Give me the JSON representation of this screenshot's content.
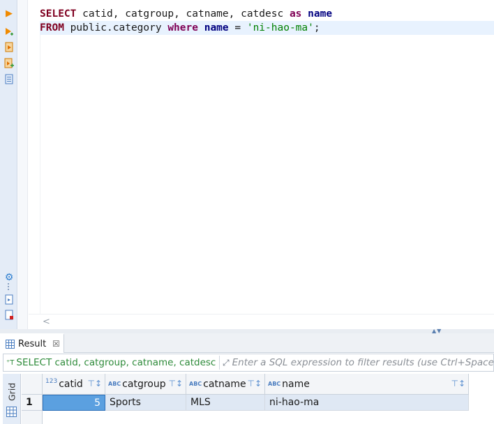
{
  "editor": {
    "line1": {
      "kw_select": "SELECT",
      "columns": " catid, catgroup, catname, catdesc ",
      "kw_as": "as",
      "space": " ",
      "alias": "name"
    },
    "line2": {
      "kw_from": "FROM",
      "table": " public.category ",
      "kw_where": "where",
      "space": " ",
      "col": "name",
      "op": " = ",
      "literal": "'ni-hao-ma'",
      "semicolon": ";"
    }
  },
  "result_panel": {
    "tab_label": "Result",
    "tab_close": "☒",
    "filter": {
      "query_text": "SELECT catid, catgroup, catname, catdesc a",
      "placeholder": "Enter a SQL expression to filter results (use Ctrl+Space)"
    },
    "view_mode_label": "Grid",
    "columns": [
      {
        "type_badge": "123",
        "name": "catid"
      },
      {
        "type_badge": "ABC",
        "name": "catgroup"
      },
      {
        "type_badge": "ABC",
        "name": "catname"
      },
      {
        "type_badge": "ABC",
        "name": "name"
      }
    ],
    "rows": [
      {
        "row_number": "1",
        "cells": [
          "5",
          "Sports",
          "MLS",
          "ni-hao-ma"
        ]
      }
    ]
  },
  "colors": {
    "accent": "#2f8fe0",
    "keyword": "#7f0020",
    "string_literal": "#008000",
    "selected_cell": "#5ba0e0",
    "filter_sql_text": "#2e8b3a"
  },
  "icons": {
    "ruler": [
      "execute-statement-icon",
      "execute-statement-new-tab-icon",
      "execute-script-icon",
      "execute-script-new-tab-icon",
      "explain-plan-icon",
      "settings-gear-icon",
      "export-icon",
      "load-script-icon"
    ]
  }
}
